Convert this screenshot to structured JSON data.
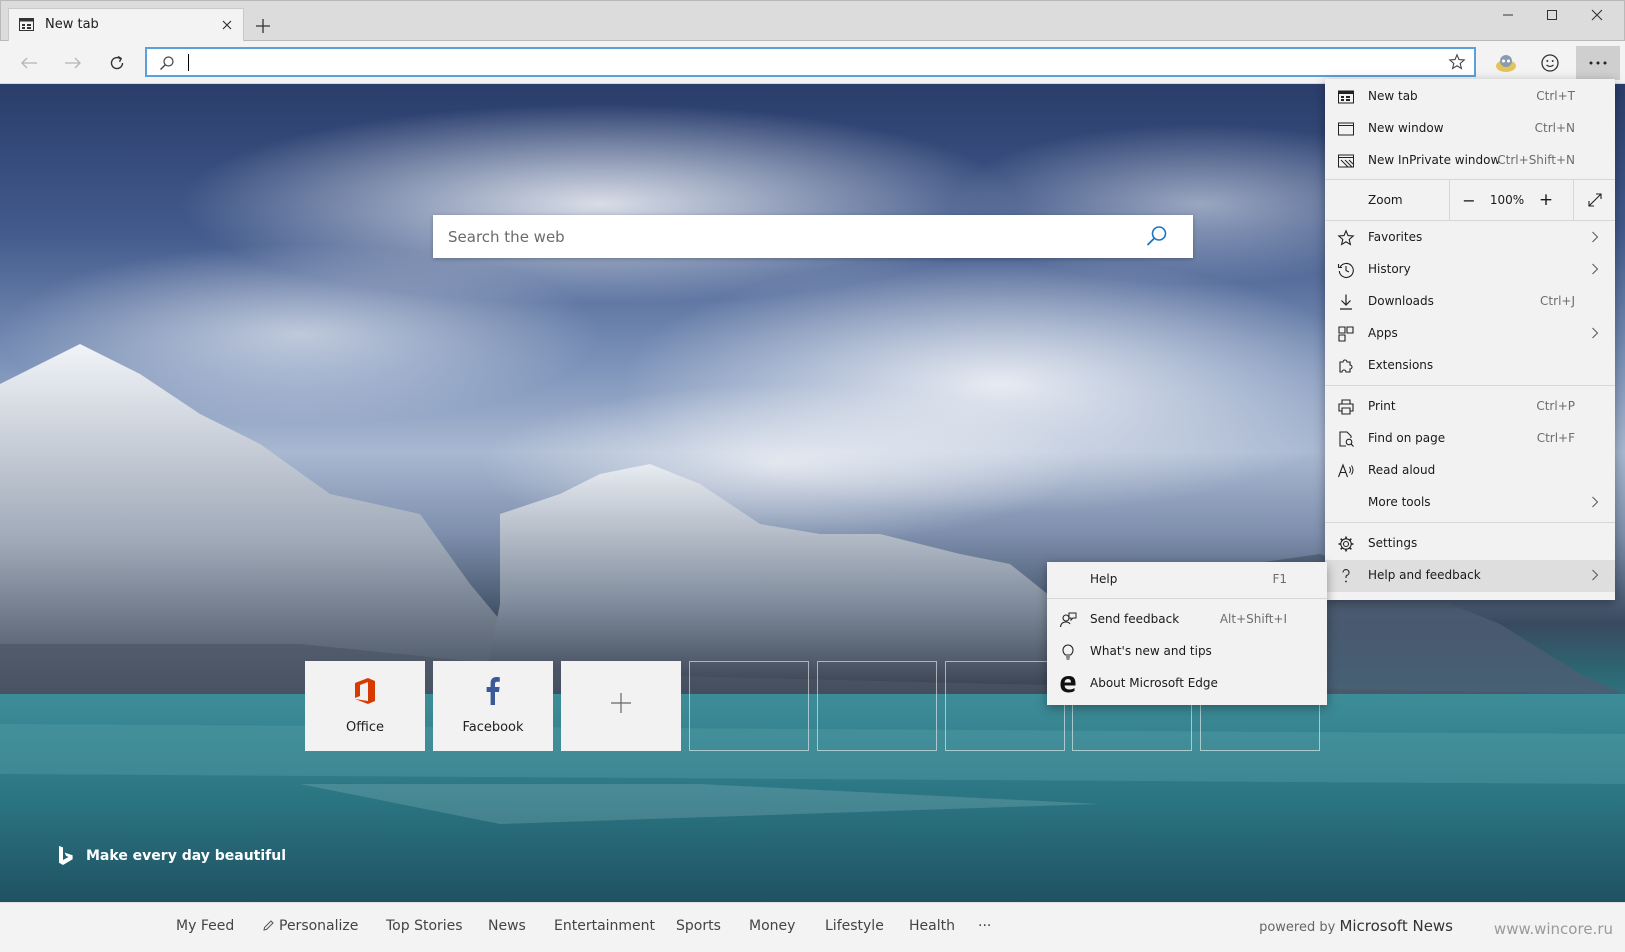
{
  "tab": {
    "title": "New tab"
  },
  "page": {
    "search_placeholder": "Search the web",
    "tiles": [
      {
        "label": "Office",
        "icon": "office-icon"
      },
      {
        "label": "Facebook",
        "icon": "facebook-icon"
      },
      {
        "label": "",
        "icon": "plus-icon"
      }
    ],
    "bing_tagline": "Make every day beautiful"
  },
  "feed": {
    "items": [
      "My Feed",
      "Personalize",
      "Top Stories",
      "News",
      "Entertainment",
      "Sports",
      "Money",
      "Lifestyle",
      "Health",
      "···"
    ],
    "powered_prefix": "powered by",
    "powered_brand": "Microsoft News",
    "watermark": "www.wincore.ru"
  },
  "menu": {
    "items": [
      {
        "label": "New tab",
        "shortcut": "Ctrl+T",
        "icon": "new-tab-icon"
      },
      {
        "label": "New window",
        "shortcut": "Ctrl+N",
        "icon": "new-window-icon"
      },
      {
        "label": "New InPrivate window",
        "shortcut": "Ctrl+Shift+N",
        "icon": "inprivate-icon"
      },
      {
        "label": "Favorites",
        "shortcut": "",
        "icon": "star-icon",
        "submenu": true
      },
      {
        "label": "History",
        "shortcut": "",
        "icon": "history-icon",
        "submenu": true
      },
      {
        "label": "Downloads",
        "shortcut": "Ctrl+J",
        "icon": "download-icon"
      },
      {
        "label": "Apps",
        "shortcut": "",
        "icon": "apps-icon",
        "submenu": true
      },
      {
        "label": "Extensions",
        "shortcut": "",
        "icon": "extensions-icon"
      },
      {
        "label": "Print",
        "shortcut": "Ctrl+P",
        "icon": "print-icon"
      },
      {
        "label": "Find on page",
        "shortcut": "Ctrl+F",
        "icon": "find-icon"
      },
      {
        "label": "Read aloud",
        "shortcut": "",
        "icon": "read-aloud-icon"
      },
      {
        "label": "More tools",
        "shortcut": "",
        "icon": "",
        "submenu": true
      },
      {
        "label": "Settings",
        "shortcut": "",
        "icon": "gear-icon"
      },
      {
        "label": "Help and feedback",
        "shortcut": "",
        "icon": "help-icon",
        "submenu": true
      }
    ],
    "zoom": {
      "label": "Zoom",
      "value": "100%",
      "minus": "−",
      "plus": "+"
    }
  },
  "submenu": {
    "items": [
      {
        "label": "Help",
        "shortcut": "F1",
        "icon": ""
      },
      {
        "label": "Send feedback",
        "shortcut": "Alt+Shift+I",
        "icon": "feedback-icon"
      },
      {
        "label": "What's new and tips",
        "shortcut": "",
        "icon": "lightbulb-icon"
      },
      {
        "label": "About Microsoft Edge",
        "shortcut": "",
        "icon": "edge-logo-icon"
      }
    ]
  },
  "colors": {
    "accent": "#5aa0dc",
    "office_red": "#d83b01",
    "facebook_blue": "#3b5998"
  }
}
